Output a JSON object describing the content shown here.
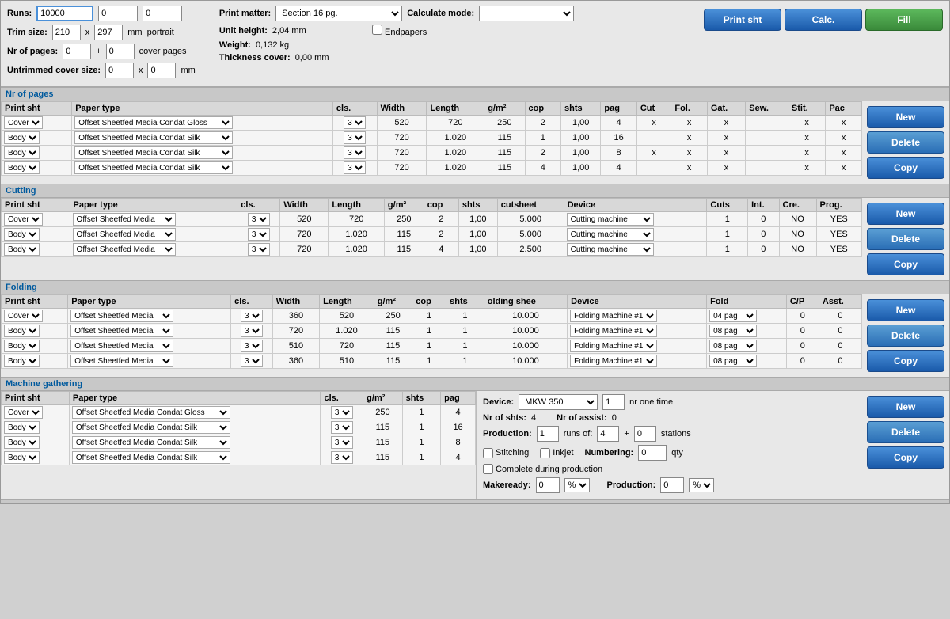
{
  "header": {
    "runs_label": "Runs:",
    "runs_value": "10000",
    "runs_val2": "0",
    "runs_val3": "0",
    "trim_label": "Trim size:",
    "trim_w": "210",
    "trim_x": "x",
    "trim_h": "297",
    "trim_unit": "mm",
    "trim_orient": "portrait",
    "pages_label": "Nr of pages:",
    "pages_val": "0",
    "pages_plus": "+",
    "pages_val2": "0",
    "pages_suffix": "cover pages",
    "untrimed_label": "Untrimmed cover size:",
    "untrimed_w": "0",
    "untrimed_x": "x",
    "untrimed_h": "0",
    "untrimed_unit": "mm",
    "print_matter_label": "Print matter:",
    "print_matter_val": "Section 16 pg.",
    "unit_height_label": "Unit height:",
    "unit_height_val": "2,04 mm",
    "weight_label": "Weight:",
    "weight_val": "0,132 kg",
    "thickness_label": "Thickness cover:",
    "thickness_val": "0,00 mm",
    "calc_mode_label": "Calculate mode:",
    "endpapers_label": "Endpapers",
    "btn_print_sht": "Print sht",
    "btn_calc": "Calc.",
    "btn_fill": "Fill"
  },
  "nr_of_pages": {
    "section_title": "Nr of pages",
    "columns": [
      "Print sht",
      "Paper type",
      "cls.",
      "Width",
      "Length",
      "g/m²",
      "cop",
      "shts",
      "pag",
      "Cut",
      "Fol.",
      "Gat.",
      "Sew.",
      "Stit.",
      "Pac"
    ],
    "rows": [
      {
        "print_sht": "Cover",
        "paper_type": "Offset Sheetfed Media Condat Gloss",
        "cls": "3",
        "width": "520",
        "length": "720",
        "gsm": "250",
        "cop": "2",
        "shts": "1,00",
        "pag": "4",
        "cut": "x",
        "fol": "x",
        "gat": "x",
        "sew": "",
        "stit": "x",
        "pac": "x"
      },
      {
        "print_sht": "Body",
        "paper_type": "Offset Sheetfed Media Condat Silk",
        "cls": "3",
        "width": "720",
        "length": "1.020",
        "gsm": "115",
        "cop": "1",
        "shts": "1,00",
        "pag": "16",
        "cut": "",
        "fol": "x",
        "gat": "x",
        "sew": "",
        "stit": "x",
        "pac": "x"
      },
      {
        "print_sht": "Body",
        "paper_type": "Offset Sheetfed Media Condat Silk",
        "cls": "3",
        "width": "720",
        "length": "1.020",
        "gsm": "115",
        "cop": "2",
        "shts": "1,00",
        "pag": "8",
        "cut": "x",
        "fol": "x",
        "gat": "x",
        "sew": "",
        "stit": "x",
        "pac": "x"
      },
      {
        "print_sht": "Body",
        "paper_type": "Offset Sheetfed Media Condat Silk",
        "cls": "3",
        "width": "720",
        "length": "1.020",
        "gsm": "115",
        "cop": "4",
        "shts": "1,00",
        "pag": "4",
        "cut": "",
        "fol": "x",
        "gat": "x",
        "sew": "",
        "stit": "x",
        "pac": "x"
      }
    ],
    "btn_new": "New",
    "btn_delete": "Delete",
    "btn_copy": "Copy"
  },
  "cutting": {
    "section_title": "Cutting",
    "columns": [
      "Print sht",
      "Paper type",
      "cls.",
      "Width",
      "Length",
      "g/m²",
      "cop",
      "shts",
      "cutsheet",
      "Device",
      "Cuts",
      "Int.",
      "Cre.",
      "Prog."
    ],
    "rows": [
      {
        "print_sht": "Cover",
        "paper_type": "Offset Sheetfed Media",
        "cls": "3",
        "width": "520",
        "length": "720",
        "gsm": "250",
        "cop": "2",
        "shts": "1,00",
        "cutsheet": "5.000",
        "device": "Cutting machine",
        "cuts": "1",
        "int": "0",
        "cre": "NO",
        "prog": "YES"
      },
      {
        "print_sht": "Body",
        "paper_type": "Offset Sheetfed Media",
        "cls": "3",
        "width": "720",
        "length": "1.020",
        "gsm": "115",
        "cop": "2",
        "shts": "1,00",
        "cutsheet": "5.000",
        "device": "Cutting machine",
        "cuts": "1",
        "int": "0",
        "cre": "NO",
        "prog": "YES"
      },
      {
        "print_sht": "Body",
        "paper_type": "Offset Sheetfed Media",
        "cls": "3",
        "width": "720",
        "length": "1.020",
        "gsm": "115",
        "cop": "4",
        "shts": "1,00",
        "cutsheet": "2.500",
        "device": "Cutting machine",
        "cuts": "1",
        "int": "0",
        "cre": "NO",
        "prog": "YES"
      }
    ],
    "btn_new": "New",
    "btn_delete": "Delete",
    "btn_copy": "Copy"
  },
  "folding": {
    "section_title": "Folding",
    "columns": [
      "Print sht",
      "Paper type",
      "cls.",
      "Width",
      "Length",
      "g/m²",
      "cop",
      "shts",
      "olding shee",
      "Device",
      "Fold",
      "C/P",
      "Asst."
    ],
    "rows": [
      {
        "print_sht": "Cover",
        "paper_type": "Offset Sheetfed Media",
        "cls": "3",
        "width": "360",
        "length": "520",
        "gsm": "250",
        "cop": "1",
        "shts": "1",
        "folding": "10.000",
        "device": "Folding Machine #1",
        "fold": "04 pag",
        "cp": "0",
        "asst": "0"
      },
      {
        "print_sht": "Body",
        "paper_type": "Offset Sheetfed Media",
        "cls": "3",
        "width": "720",
        "length": "1.020",
        "gsm": "115",
        "cop": "1",
        "shts": "1",
        "folding": "10.000",
        "device": "Folding Machine #1",
        "fold": "08 pag",
        "cp": "0",
        "asst": "0"
      },
      {
        "print_sht": "Body",
        "paper_type": "Offset Sheetfed Media",
        "cls": "3",
        "width": "510",
        "length": "720",
        "gsm": "115",
        "cop": "1",
        "shts": "1",
        "folding": "10.000",
        "device": "Folding Machine #1",
        "fold": "08 pag",
        "cp": "0",
        "asst": "0"
      },
      {
        "print_sht": "Body",
        "paper_type": "Offset Sheetfed Media",
        "cls": "3",
        "width": "360",
        "length": "510",
        "gsm": "115",
        "cop": "1",
        "shts": "1",
        "folding": "10.000",
        "device": "Folding Machine #1",
        "fold": "08 pag",
        "cp": "0",
        "asst": "0"
      }
    ],
    "btn_new": "New",
    "btn_delete": "Delete",
    "btn_copy": "Copy"
  },
  "machine_gathering": {
    "section_title": "Machine gathering",
    "columns": [
      "Print sht",
      "Paper type",
      "cls.",
      "g/m²",
      "shts",
      "pag"
    ],
    "rows": [
      {
        "print_sht": "Cover",
        "paper_type": "Offset Sheetfed Media Condat Gloss",
        "cls": "3",
        "gsm": "250",
        "shts": "1",
        "pag": "4"
      },
      {
        "print_sht": "Body",
        "paper_type": "Offset Sheetfed Media Condat Silk",
        "cls": "3",
        "gsm": "115",
        "shts": "1",
        "pag": "16"
      },
      {
        "print_sht": "Body",
        "paper_type": "Offset Sheetfed Media Condat Silk",
        "cls": "3",
        "gsm": "115",
        "shts": "1",
        "pag": "8"
      },
      {
        "print_sht": "Body",
        "paper_type": "Offset Sheetfed Media Condat Silk",
        "cls": "3",
        "gsm": "115",
        "shts": "1",
        "pag": "4"
      }
    ],
    "device_label": "Device:",
    "device_val": "MKW 350",
    "device_num": "1",
    "nr_one_time": "nr one time",
    "nr_shts_label": "Nr of shts:",
    "nr_shts_val": "4",
    "nr_assist_label": "Nr of assist:",
    "nr_assist_val": "0",
    "production_label": "Production:",
    "production_val": "1",
    "runs_of_label": "runs of:",
    "runs_of_val": "4",
    "plus_val": "+",
    "zero_val": "0",
    "stations_label": "stations",
    "stitching_label": "Stitching",
    "inkjet_label": "Inkjet",
    "numbering_label": "Numbering:",
    "numbering_val": "0",
    "qty_label": "qty",
    "complete_label": "Complete during production",
    "makeready_label": "Makeready:",
    "makeready_val": "0",
    "makeready_pct": "%",
    "production2_label": "Production:",
    "production2_val": "0",
    "production2_pct": "%",
    "btn_new": "New",
    "btn_delete": "Delete",
    "btn_copy": "Copy"
  },
  "footer": {
    "text": ""
  }
}
